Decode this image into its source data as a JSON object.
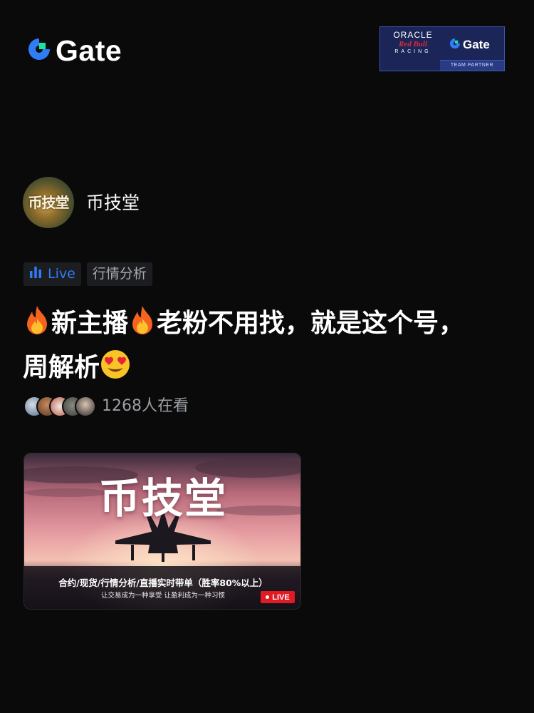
{
  "header": {
    "brand_name": "Gate",
    "partner": {
      "oracle": "ORACLE",
      "redbull": "Red Bull",
      "racing": "RACING",
      "gate": "Gate",
      "team_partner": "TEAM PARTNER"
    }
  },
  "host": {
    "avatar_text": "币技堂",
    "name": "币技堂"
  },
  "tags": {
    "live_label": "Live",
    "topic_label": "行情分析"
  },
  "stream": {
    "title_part1": "新主播",
    "title_part2": "老粉不用找，就是这个号，周解析",
    "viewer_count": "1268人在看"
  },
  "thumbnail": {
    "title": "币技堂",
    "subtitle": "合约/现货/行情分析/直播实时带单（胜率80%以上）",
    "slogan": "让交易成为一种享受     让盈利成为一种习惯",
    "live_badge": "LIVE"
  },
  "colors": {
    "background": "#0a0a0b",
    "accent_blue": "#2f7cf6",
    "live_red": "#e01b24",
    "gate_green": "#17e6a1"
  }
}
